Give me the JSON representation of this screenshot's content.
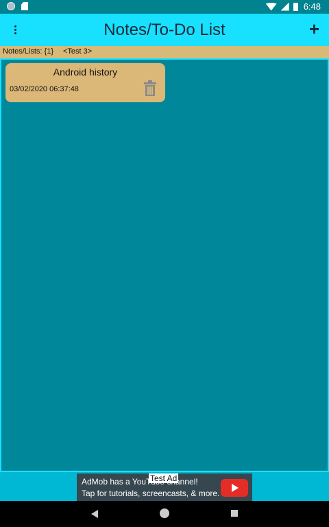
{
  "status_bar": {
    "time": "6:48",
    "left_icons": [
      "notification-dot-icon",
      "sd-card-icon"
    ],
    "right_icons": [
      "wifi-icon",
      "cell-signal-icon",
      "battery-icon"
    ]
  },
  "app_bar": {
    "title": "Notes/To-Do List",
    "menu_icon": "overflow-menu-icon",
    "add_label": "+"
  },
  "info_bar": {
    "count_text": "Notes/Lists: {1}",
    "current_list": "<Test 3>"
  },
  "notes": [
    {
      "title": "Android history",
      "date": "03/02/2020 06:37:48",
      "icon": "trash-icon"
    }
  ],
  "ad": {
    "line1": "AdMob has a YouTube channel!",
    "line2": "Tap for tutorials, screencasts, & more.",
    "label": "Test Ad",
    "icon": "youtube-play-icon"
  },
  "colors": {
    "status_bar": "#00838f",
    "app_bar": "#18e0ff",
    "list_background": "#00879a",
    "card": "#dbb778",
    "info_bar": "#d8b978"
  }
}
